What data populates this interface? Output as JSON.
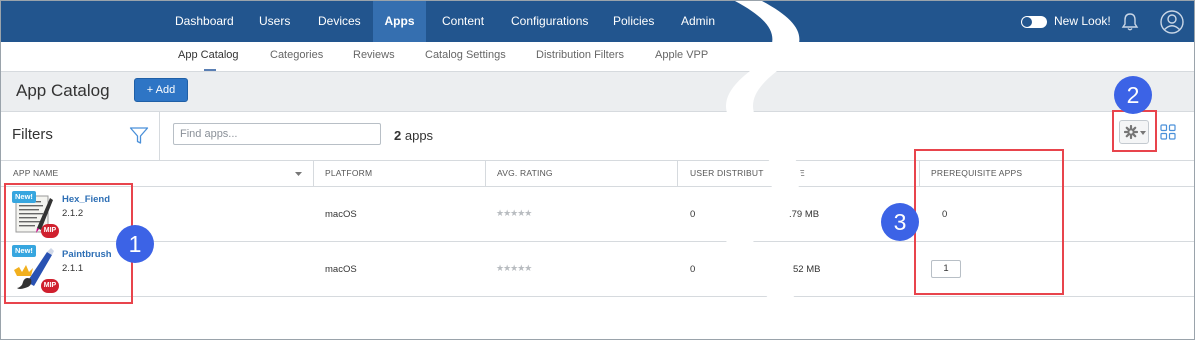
{
  "nav": {
    "items": [
      "Dashboard",
      "Users",
      "Devices",
      "Apps",
      "Content",
      "Configurations",
      "Policies",
      "Admin"
    ],
    "active": "Apps",
    "new_look_label": "New Look!"
  },
  "subnav": {
    "items": [
      "App Catalog",
      "Categories",
      "Reviews",
      "Catalog Settings",
      "Distribution Filters",
      "Apple VPP"
    ],
    "active": "App Catalog"
  },
  "page": {
    "title": "App Catalog",
    "add_label": "+ Add"
  },
  "filters": {
    "label": "Filters",
    "search_placeholder": "Find apps...",
    "count_number": "2",
    "count_label": "apps"
  },
  "table": {
    "columns": [
      "APP NAME",
      "PLATFORM",
      "AVG. RATING",
      "USER DISTRIBUT",
      "IZE",
      "PREREQUISITE APPS"
    ],
    "rows": [
      {
        "name": "Hex_Fiend",
        "version": "2.1.2",
        "new_badge": "New!",
        "mip_badge": "MIP",
        "platform": "macOS",
        "rating": "★★★★★",
        "user_distribution": "0",
        "size": ".79 MB",
        "prerequisite_apps": "0"
      },
      {
        "name": "Paintbrush",
        "version": "2.1.1",
        "new_badge": "New!",
        "mip_badge": "MIP",
        "platform": "macOS",
        "rating": "★★★★★",
        "user_distribution": "0",
        "size": "52 MB",
        "prerequisite_apps": "1"
      }
    ]
  },
  "callouts": [
    "1",
    "2",
    "3"
  ],
  "colors": {
    "nav_bg": "#22558e",
    "nav_active": "#356fb0",
    "accent_button": "#2e75c5",
    "highlight_red": "#e8444c",
    "callout_blue": "#3c63e6",
    "new_badge": "#37a6df",
    "mip_badge": "#d0202e",
    "link_blue": "#2e6fb5"
  },
  "icons": [
    "filter-funnel-icon",
    "gear-icon",
    "grid-view-icon",
    "bell-icon",
    "user-avatar-icon",
    "toggle-switch-icon",
    "sort-caret-icon"
  ]
}
